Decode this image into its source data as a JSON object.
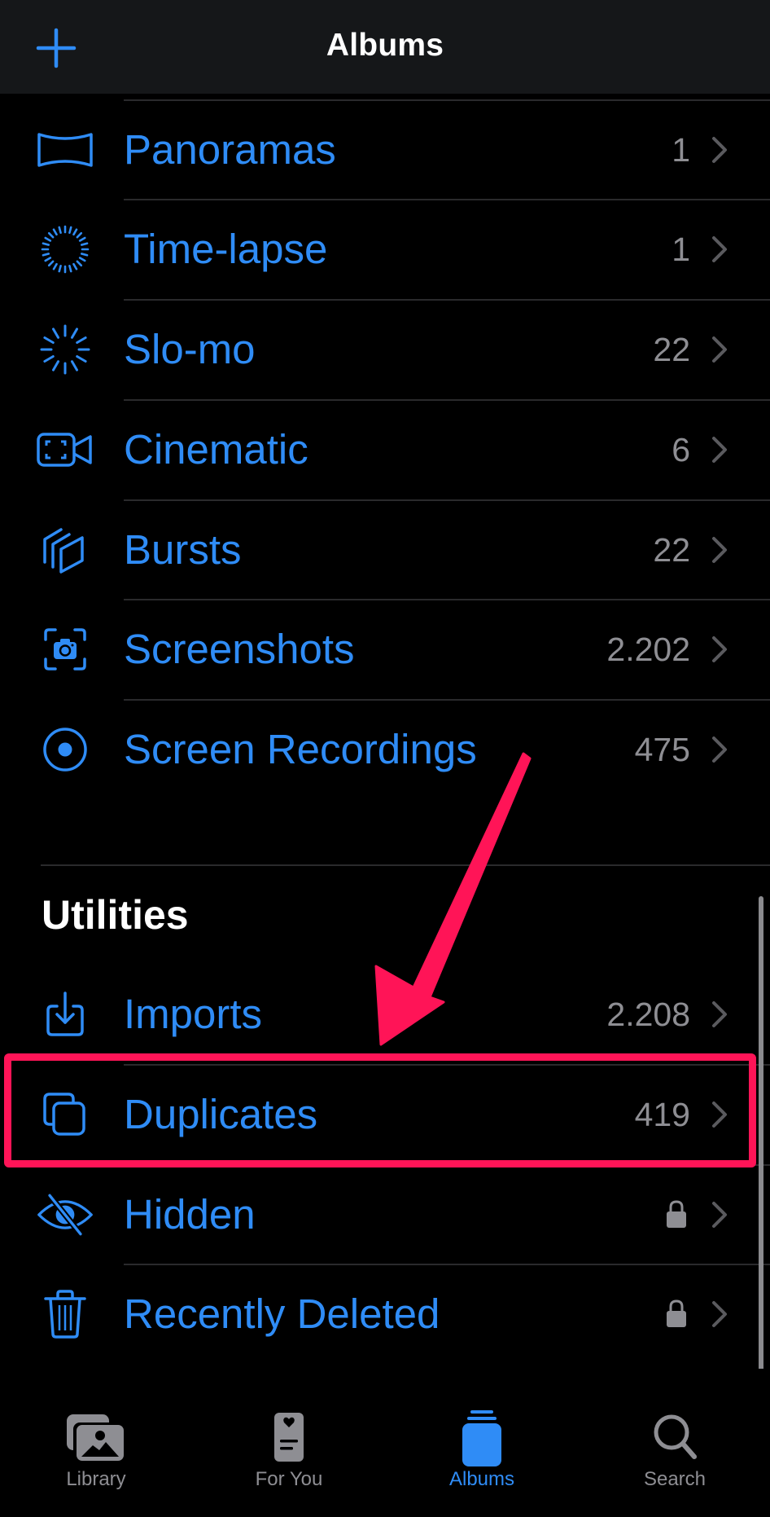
{
  "navbar": {
    "title": "Albums",
    "add_icon": "plus-icon"
  },
  "colors": {
    "accent": "#2f8cf6",
    "count": "#8e8e93",
    "chevron": "#5a5a5e",
    "annotation": "#ff1457"
  },
  "media_types": [
    {
      "label": "Panoramas",
      "count": "1",
      "icon": "panorama-icon"
    },
    {
      "label": "Time-lapse",
      "count": "1",
      "icon": "timelapse-icon"
    },
    {
      "label": "Slo-mo",
      "count": "22",
      "icon": "slomo-icon"
    },
    {
      "label": "Cinematic",
      "count": "6",
      "icon": "cinematic-icon"
    },
    {
      "label": "Bursts",
      "count": "22",
      "icon": "bursts-icon"
    },
    {
      "label": "Screenshots",
      "count": "2.202",
      "icon": "screenshot-icon"
    },
    {
      "label": "Screen Recordings",
      "count": "475",
      "icon": "screen-recording-icon"
    }
  ],
  "utilities": {
    "title": "Utilities",
    "items": [
      {
        "label": "Imports",
        "count": "2.208",
        "icon": "import-icon",
        "locked": false
      },
      {
        "label": "Duplicates",
        "count": "419",
        "icon": "duplicates-icon",
        "locked": false,
        "highlighted": true
      },
      {
        "label": "Hidden",
        "count": "",
        "icon": "eye-slash-icon",
        "locked": true
      },
      {
        "label": "Recently Deleted",
        "count": "",
        "icon": "trash-icon",
        "locked": true
      }
    ]
  },
  "tabbar": {
    "tabs": [
      {
        "label": "Library",
        "icon": "photo-library-icon",
        "active": false
      },
      {
        "label": "For You",
        "icon": "for-you-icon",
        "active": false
      },
      {
        "label": "Albums",
        "icon": "albums-icon",
        "active": true
      },
      {
        "label": "Search",
        "icon": "search-icon",
        "active": false
      }
    ]
  }
}
